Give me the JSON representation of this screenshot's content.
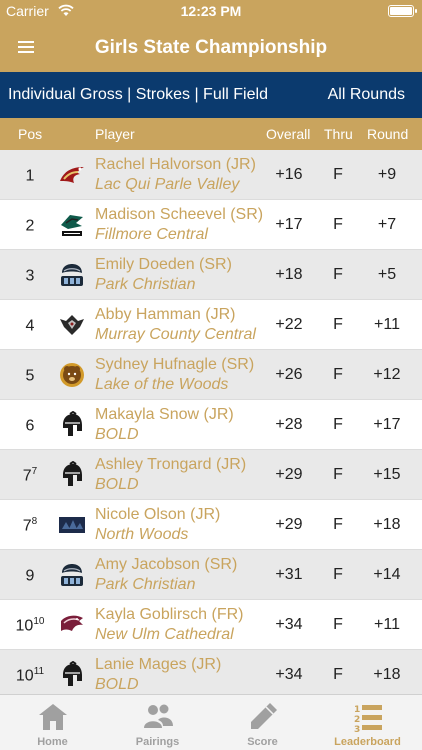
{
  "status": {
    "carrier": "Carrier",
    "time": "12:23 PM"
  },
  "nav": {
    "title": "Girls State Championship"
  },
  "filter": {
    "left": "Individual Gross | Strokes | Full Field",
    "right": "All Rounds"
  },
  "columns": {
    "pos": "Pos",
    "player": "Player",
    "overall": "Overall",
    "thru": "Thru",
    "round": "Round"
  },
  "rows": [
    {
      "pos": "1",
      "tie": "",
      "name": "Rachel Halvorson (JR)",
      "school": "Lac Qui Parle Valley",
      "overall": "+16",
      "thru": "F",
      "round": "+9",
      "logo": "eagle-logo-icon"
    },
    {
      "pos": "2",
      "tie": "",
      "name": "Madison Scheevel (SR)",
      "school": "Fillmore Central",
      "overall": "+17",
      "thru": "F",
      "round": "+7",
      "logo": "falcons-logo-icon"
    },
    {
      "pos": "3",
      "tie": "",
      "name": "Emily Doeden (SR)",
      "school": "Park Christian",
      "overall": "+18",
      "thru": "F",
      "round": "+5",
      "logo": "pc-logo-icon"
    },
    {
      "pos": "4",
      "tie": "",
      "name": "Abby Hamman (JR)",
      "school": "Murray County Central",
      "overall": "+22",
      "thru": "F",
      "round": "+11",
      "logo": "rebel-logo-icon"
    },
    {
      "pos": "5",
      "tie": "",
      "name": "Sydney Hufnagle (SR)",
      "school": "Lake of the Woods",
      "overall": "+26",
      "thru": "F",
      "round": "+12",
      "logo": "bear-logo-icon"
    },
    {
      "pos": "6",
      "tie": "",
      "name": "Makayla Snow (JR)",
      "school": "BOLD",
      "overall": "+28",
      "thru": "F",
      "round": "+17",
      "logo": "spartan-logo-icon"
    },
    {
      "pos": "7",
      "tie": "7",
      "name": "Ashley Trongard (JR)",
      "school": "BOLD",
      "overall": "+29",
      "thru": "F",
      "round": "+15",
      "logo": "spartan-logo-icon"
    },
    {
      "pos": "7",
      "tie": "8",
      "name": "Nicole Olson (JR)",
      "school": "North Woods",
      "overall": "+29",
      "thru": "F",
      "round": "+18",
      "logo": "northwoods-logo-icon"
    },
    {
      "pos": "9",
      "tie": "",
      "name": "Amy Jacobson (SR)",
      "school": "Park Christian",
      "overall": "+31",
      "thru": "F",
      "round": "+14",
      "logo": "pc-logo-icon"
    },
    {
      "pos": "10",
      "tie": "10",
      "name": "Kayla Goblirsch (FR)",
      "school": "New Ulm Cathedral",
      "overall": "+34",
      "thru": "F",
      "round": "+11",
      "logo": "greyhound-logo-icon"
    },
    {
      "pos": "10",
      "tie": "11",
      "name": "Lanie Mages (JR)",
      "school": "BOLD",
      "overall": "+34",
      "thru": "F",
      "round": "+18",
      "logo": "spartan-logo-icon"
    }
  ],
  "tabs": [
    {
      "label": "Home",
      "icon": "home-icon"
    },
    {
      "label": "Pairings",
      "icon": "people-icon"
    },
    {
      "label": "Score",
      "icon": "pencil-icon"
    },
    {
      "label": "Leaderboard",
      "icon": "leaderboard-icon"
    }
  ],
  "colors": {
    "gold": "#c9a45e",
    "navy": "#0b3a6e",
    "rowAlt": "#e9e9e9"
  }
}
